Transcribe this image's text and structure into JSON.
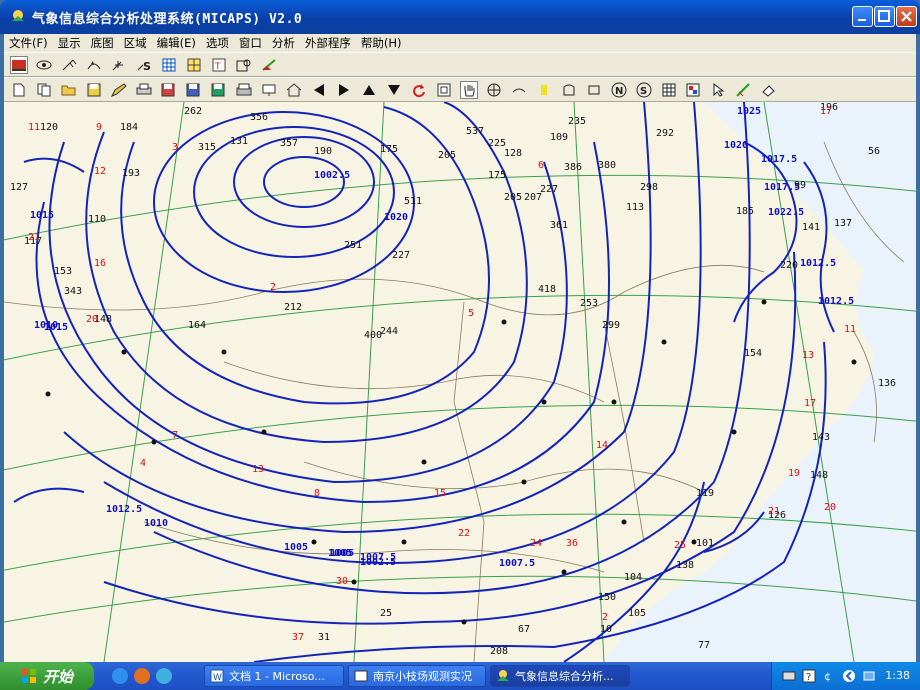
{
  "window": {
    "title": "气象信息综合分析处理系统(MICAPS) V2.0"
  },
  "menu": [
    "文件(F)",
    "显示",
    "底图",
    "区域",
    "编辑(E)",
    "选项",
    "窗口",
    "分析",
    "外部程序",
    "帮助(H)"
  ],
  "toolbar1_icons": [
    "station-map-icon",
    "eye-icon",
    "wind-barb-icon",
    "front-icon",
    "grid-icon",
    "streamline-icon",
    "table-icon",
    "sounding-icon",
    "text-panel-icon",
    "profile-icon",
    "export-icon"
  ],
  "toolbar2_icons": [
    "document-icon",
    "copy-icon",
    "open-folder-icon",
    "save-icon",
    "edit-icon",
    "print-icon",
    "save-as-icon",
    "load-icon",
    "load-plus-icon",
    "print-preview-icon",
    "station-icon",
    "home-icon",
    "arrow-left-icon",
    "arrow-right-icon",
    "arrow-up-icon",
    "arrow-down-icon",
    "refresh-icon",
    "zoom-box-icon",
    "pan-hand-icon",
    "center-icon",
    "curve-icon",
    "yellow-rect-icon",
    "shape-icon",
    "rectangle-icon",
    "north-symbol-icon",
    "south-symbol-icon",
    "grid-table-icon",
    "color-legend-icon",
    "cursor-arrow-icon",
    "measure-icon",
    "erase-icon"
  ],
  "map": {
    "isobar_labels": [
      "1025",
      "1020",
      "1017.5",
      "1015",
      "1012.5",
      "1010",
      "1007.5",
      "1005",
      "1002.5",
      "1012.5",
      "1015",
      "1017.5",
      "1022.5",
      "1020",
      "1012.5",
      "1010",
      "1005",
      "1007.5",
      "1002.5",
      "1005"
    ],
    "station_values_black": [
      "120",
      "184",
      "262",
      "356",
      "315",
      "131",
      "357",
      "190",
      "175",
      "205",
      "537",
      "225",
      "128",
      "109",
      "235",
      "292",
      "196",
      "56",
      "193",
      "175",
      "386",
      "127",
      "511",
      "227",
      "205",
      "207",
      "227",
      "380",
      "298",
      "113",
      "185",
      "99",
      "148",
      "153",
      "343",
      "110",
      "117",
      "164",
      "212",
      "400",
      "244",
      "418",
      "253",
      "299",
      "154",
      "136",
      "143",
      "148",
      "119",
      "101",
      "104",
      "150",
      "105",
      "208",
      "77",
      "31",
      "67",
      "25",
      "10",
      "138",
      "137",
      "126",
      "220",
      "251",
      "361",
      "141"
    ],
    "station_values_red": [
      "11",
      "9",
      "12",
      "21",
      "16",
      "20",
      "17",
      "6",
      "7",
      "4",
      "3",
      "2",
      "5",
      "8",
      "13",
      "15",
      "14",
      "19",
      "22",
      "24",
      "25",
      "30",
      "37",
      "36",
      "2",
      "11",
      "13",
      "21",
      "20",
      "17"
    ]
  },
  "taskbar": {
    "start_label": "开始",
    "tasks": [
      "文档 1 - Microso...",
      "南京小枝场观测实况",
      "气象信息综合分析..."
    ],
    "clock": "1:38"
  }
}
